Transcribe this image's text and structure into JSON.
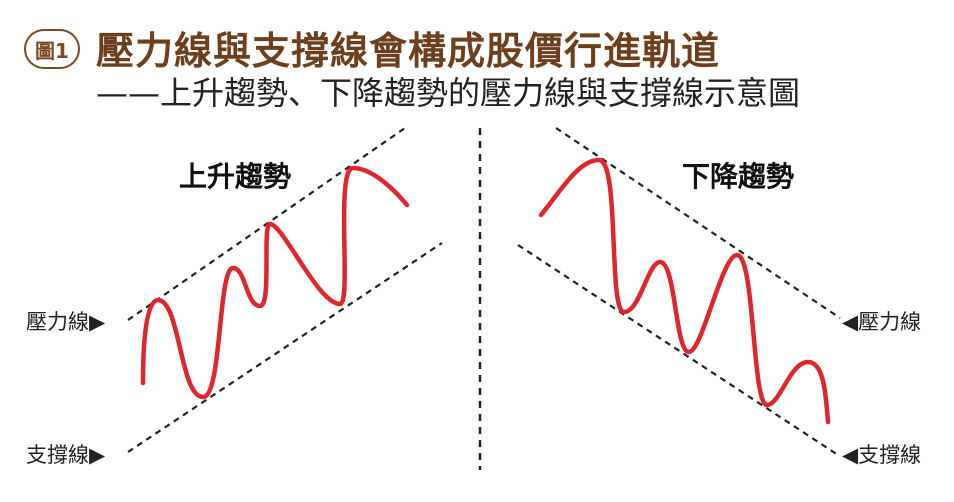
{
  "header": {
    "badge": "圖1",
    "title": "壓力線與支撐線會構成股價行進軌道",
    "subtitle": "——上升趨勢、下降趨勢的壓力線與支撐線示意圖"
  },
  "panels": {
    "left": {
      "title": "上升趨勢",
      "resistance_label": "壓力線▶",
      "support_label": "支撐線▶"
    },
    "right": {
      "title": "下降趨勢",
      "resistance_label": "◀壓力線",
      "support_label": "◀支撐線"
    }
  },
  "colors": {
    "accent_brown": "#7a4a22",
    "price_line": "#e0252b",
    "guide_line": "#222222"
  }
}
